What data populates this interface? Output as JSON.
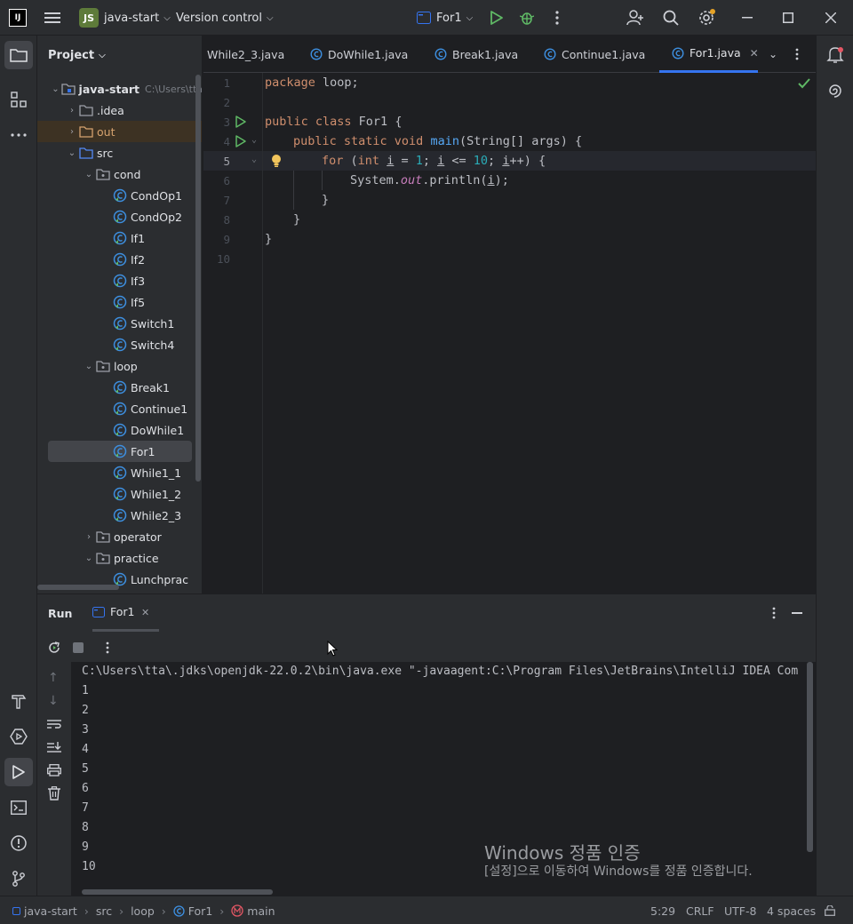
{
  "titlebar": {
    "project_badge": "JS",
    "project_name": "java-start",
    "vcs": "Version control",
    "run_config": "For1"
  },
  "project_panel": {
    "title": "Project",
    "root_label": "java-start",
    "root_path": "C:\\Users\\tta",
    "items": [
      {
        "label": ".idea"
      },
      {
        "label": "out"
      },
      {
        "label": "src"
      },
      {
        "label": "cond"
      },
      {
        "label": "CondOp1"
      },
      {
        "label": "CondOp2"
      },
      {
        "label": "If1"
      },
      {
        "label": "If2"
      },
      {
        "label": "If3"
      },
      {
        "label": "If5"
      },
      {
        "label": "Switch1"
      },
      {
        "label": "Switch4"
      },
      {
        "label": "loop"
      },
      {
        "label": "Break1"
      },
      {
        "label": "Continue1"
      },
      {
        "label": "DoWhile1"
      },
      {
        "label": "For1"
      },
      {
        "label": "While1_1"
      },
      {
        "label": "While1_2"
      },
      {
        "label": "While2_3"
      },
      {
        "label": "operator"
      },
      {
        "label": "practice"
      },
      {
        "label": "Lunchprac"
      }
    ]
  },
  "tabs": [
    {
      "label": "While2_3.java"
    },
    {
      "label": "DoWhile1.java"
    },
    {
      "label": "Break1.java"
    },
    {
      "label": "Continue1.java"
    },
    {
      "label": "For1.java"
    }
  ],
  "editor": {
    "line_numbers": [
      "1",
      "2",
      "3",
      "4",
      "5",
      "6",
      "7",
      "8",
      "9",
      "10"
    ],
    "lines": {
      "l1_kw": "package",
      "l1_rest": " loop;",
      "l3_kw": "public class",
      "l3_rest": " For1 {",
      "l4_kw": "public static void",
      "l4_fn": "main",
      "l4_rest": "(String[] args) {",
      "l5_for": "for",
      "l5_a": " (",
      "l5_int": "int",
      "l5_i1": "i",
      "l5_b": " = ",
      "l5_n1": "1",
      "l5_c": "; ",
      "l5_i2": "i",
      "l5_d": " <= ",
      "l5_n2": "10",
      "l5_e": "; ",
      "l5_i3": "i",
      "l5_f": "++) {",
      "l6_a": "System.",
      "l6_out": "out",
      "l6_b": ".println(",
      "l6_i": "i",
      "l6_c": ");",
      "l7": "}",
      "l8": "}",
      "l9": "}"
    }
  },
  "run_panel": {
    "title": "Run",
    "tab_label": "For1",
    "command": "C:\\Users\\tta\\.jdks\\openjdk-22.0.2\\bin\\java.exe \"-javaagent:C:\\Program Files\\JetBrains\\IntelliJ IDEA Com",
    "output": [
      "1",
      "2",
      "3",
      "4",
      "5",
      "6",
      "7",
      "8",
      "9",
      "10"
    ]
  },
  "watermark": {
    "line1": "Windows 정품 인증",
    "line2": "[설정]으로 이동하여 Windows를 정품 인증합니다."
  },
  "statusbar": {
    "breadcrumb": [
      "java-start",
      "src",
      "loop",
      "For1",
      "main"
    ],
    "position": "5:29",
    "line_sep": "CRLF",
    "encoding": "UTF-8",
    "indent": "4 spaces"
  },
  "colors": {
    "accent": "#3574f0",
    "run_green": "#5fb865",
    "class_icon": "#3d8fe0"
  }
}
